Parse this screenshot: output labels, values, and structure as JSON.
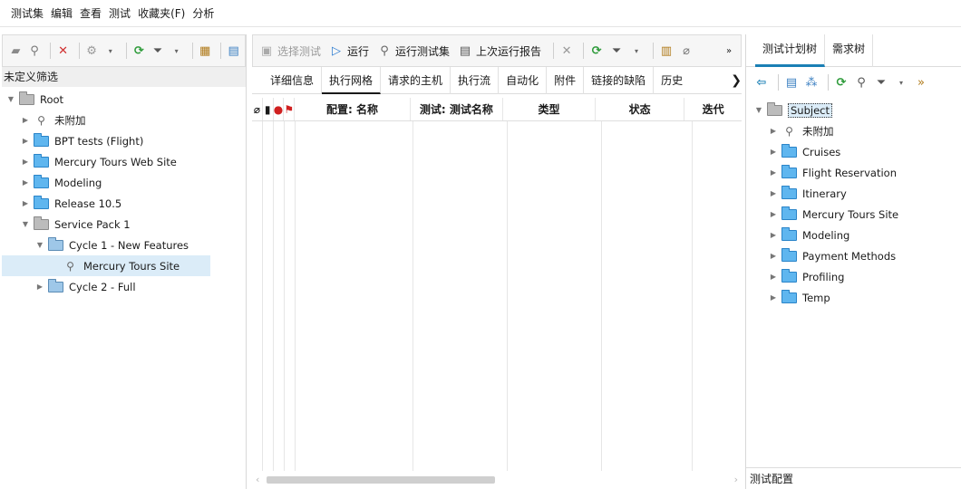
{
  "menu": [
    "测试集",
    "编辑",
    "查看",
    "测试",
    "收藏夹(F)",
    "分析"
  ],
  "left": {
    "filter_label": "未定义筛选",
    "tree": [
      {
        "label": "Root",
        "level": 0,
        "expanded": true,
        "icon": "folder-gray"
      },
      {
        "label": "未附加",
        "level": 1,
        "icon": "unattached-icon"
      },
      {
        "label": "BPT tests (Flight)",
        "level": 1,
        "icon": "folder-blue"
      },
      {
        "label": "Mercury Tours Web Site",
        "level": 1,
        "icon": "folder-blue"
      },
      {
        "label": "Modeling",
        "level": 1,
        "icon": "folder-blue"
      },
      {
        "label": "Release 10.5",
        "level": 1,
        "icon": "folder-blue"
      },
      {
        "label": "Service Pack 1",
        "level": 1,
        "expanded": true,
        "icon": "folder-gray"
      },
      {
        "label": "Cycle 1 - New Features",
        "level": 2,
        "expanded": true,
        "icon": "folder-cycle"
      },
      {
        "label": "Mercury Tours Site",
        "level": 3,
        "icon": "test-set-icon",
        "selected": true
      },
      {
        "label": "Cycle 2 - Full",
        "level": 2,
        "icon": "folder-cycle"
      }
    ]
  },
  "middle": {
    "toolbar": {
      "select_tests": "选择测试",
      "run": "运行",
      "run_test_set": "运行测试集",
      "last_run_report": "上次运行报告"
    },
    "tabs": [
      "详细信息",
      "执行网格",
      "请求的主机",
      "执行流",
      "自动化",
      "附件",
      "链接的缺陷",
      "历史"
    ],
    "active_tab": "执行网格",
    "columns": [
      "配置: 名称",
      "测试: 测试名称",
      "类型",
      "状态",
      "迭代"
    ]
  },
  "right": {
    "tabs": [
      "测试计划树",
      "需求树"
    ],
    "active_tab": "测试计划树",
    "tree": [
      {
        "label": "Subject",
        "level": 0,
        "expanded": true,
        "icon": "folder-gray",
        "selected": true
      },
      {
        "label": "未附加",
        "level": 1,
        "icon": "unattached-icon"
      },
      {
        "label": "Cruises",
        "level": 1,
        "icon": "folder-blue"
      },
      {
        "label": "Flight Reservation",
        "level": 1,
        "icon": "folder-blue"
      },
      {
        "label": "Itinerary",
        "level": 1,
        "icon": "folder-blue"
      },
      {
        "label": "Mercury Tours Site",
        "level": 1,
        "icon": "folder-blue"
      },
      {
        "label": "Modeling",
        "level": 1,
        "icon": "folder-blue"
      },
      {
        "label": "Payment Methods",
        "level": 1,
        "icon": "folder-blue"
      },
      {
        "label": "Profiling",
        "level": 1,
        "icon": "folder-blue"
      },
      {
        "label": "Temp",
        "level": 1,
        "icon": "folder-blue"
      }
    ],
    "footer": "测试配置"
  }
}
